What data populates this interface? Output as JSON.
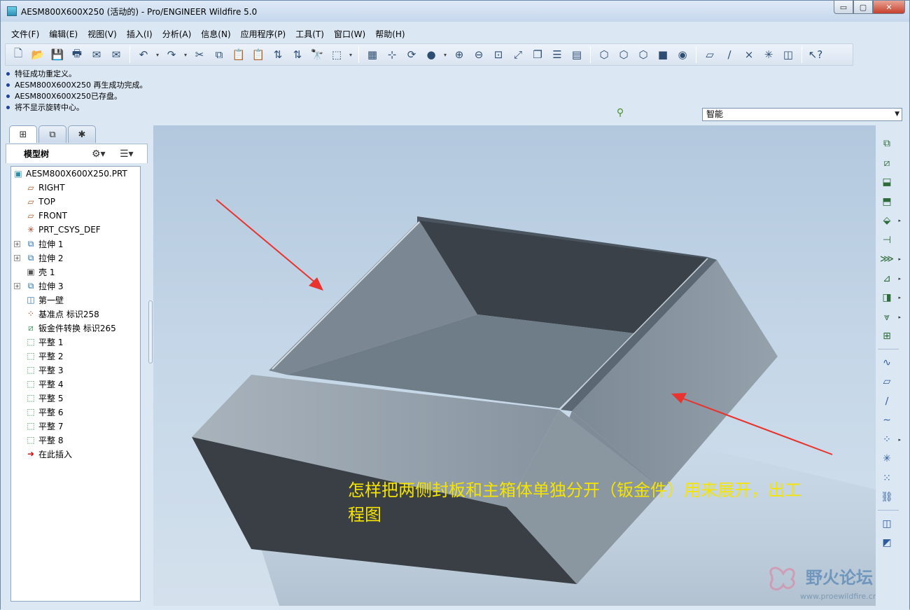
{
  "window": {
    "title": "AESM800X600X250 (活动的) - Pro/ENGINEER Wildfire 5.0",
    "buttons": {
      "minimize": "▭",
      "maximize": "▢",
      "close": "✕"
    }
  },
  "menubar": [
    "文件(F)",
    "编辑(E)",
    "视图(V)",
    "插入(I)",
    "分析(A)",
    "信息(N)",
    "应用程序(P)",
    "工具(T)",
    "窗口(W)",
    "帮助(H)"
  ],
  "toolbar": {
    "groups": [
      [
        "new-file",
        "open-file",
        "save",
        "print",
        "send-mail",
        "mail-attachment"
      ],
      [
        "undo",
        "redo",
        "cut",
        "copy",
        "paste",
        "paste-special",
        "regenerate",
        "regen-manager",
        "find",
        "select-box"
      ],
      [
        "repaint",
        "spin-center",
        "orient-mode",
        "appearance",
        "zoom-in",
        "zoom-out",
        "refit",
        "reorient",
        "saved-views",
        "layers",
        "view-manager"
      ],
      [
        "wireframe",
        "hidden-line",
        "no-hidden",
        "shading",
        "enhanced-realism"
      ],
      [
        "datum-plane-display",
        "datum-axis-display",
        "datum-point-display",
        "csys-display",
        "annotation-display"
      ],
      [
        "context-help"
      ]
    ],
    "glyphs": {
      "new-file": "🗋",
      "open-file": "📂",
      "save": "💾",
      "print": "🖶",
      "send-mail": "✉",
      "mail-attachment": "✉",
      "undo": "↶",
      "redo": "↷",
      "cut": "✂",
      "copy": "⧉",
      "paste": "📋",
      "paste-special": "📋",
      "regenerate": "⇅",
      "regen-manager": "⇅",
      "find": "🔭",
      "select-box": "⬚",
      "repaint": "▦",
      "spin-center": "⊹",
      "orient-mode": "⟳",
      "appearance": "●",
      "zoom-in": "⊕",
      "zoom-out": "⊖",
      "refit": "⊡",
      "reorient": "⤢",
      "saved-views": "❐",
      "layers": "☰",
      "view-manager": "▤",
      "wireframe": "⬡",
      "hidden-line": "⬡",
      "no-hidden": "⬡",
      "shading": "■",
      "enhanced-realism": "◉",
      "datum-plane-display": "▱",
      "datum-axis-display": "∕",
      "datum-point-display": "×",
      "csys-display": "✳",
      "annotation-display": "◫",
      "context-help": "↖?"
    }
  },
  "messages": [
    "特征成功重定义。",
    "AESM800X600X250 再生成功完成。",
    "AESM800X600X250已存盘。",
    "将不显示旋转中心。"
  ],
  "filter": {
    "value": "智能",
    "indicator": "⚲"
  },
  "navigator": {
    "tabs": [
      "model-tree-tab",
      "folder-browser-tab",
      "favorites-tab"
    ],
    "tab_glyphs": [
      "⊞",
      "⧉",
      "✱"
    ],
    "header_label": "模型树",
    "header_icons": {
      "settings": "⚙▾",
      "show": "☰▾"
    },
    "tree": [
      {
        "label": "AESM800X600X250.PRT",
        "icon": "part-icon",
        "glyph": "▣",
        "color": "#2a8fb0",
        "depth": 0,
        "expandable": false
      },
      {
        "label": "RIGHT",
        "icon": "datum-plane-icon",
        "glyph": "▱",
        "color": "#a35a2a",
        "depth": 1,
        "expandable": false
      },
      {
        "label": "TOP",
        "icon": "datum-plane-icon",
        "glyph": "▱",
        "color": "#a35a2a",
        "depth": 1,
        "expandable": false
      },
      {
        "label": "FRONT",
        "icon": "datum-plane-icon",
        "glyph": "▱",
        "color": "#a35a2a",
        "depth": 1,
        "expandable": false
      },
      {
        "label": "PRT_CSYS_DEF",
        "icon": "csys-icon",
        "glyph": "✳",
        "color": "#b04020",
        "depth": 1,
        "expandable": false
      },
      {
        "label": "拉伸 1",
        "icon": "extrude-icon",
        "glyph": "⧉",
        "color": "#2a6fb0",
        "depth": 1,
        "expandable": true
      },
      {
        "label": "拉伸 2",
        "icon": "extrude-icon",
        "glyph": "⧉",
        "color": "#2a6fb0",
        "depth": 1,
        "expandable": true
      },
      {
        "label": "壳 1",
        "icon": "shell-icon",
        "glyph": "▣",
        "color": "#555555",
        "depth": 1,
        "expandable": false
      },
      {
        "label": "拉伸 3",
        "icon": "extrude-icon",
        "glyph": "⧉",
        "color": "#2a6fb0",
        "depth": 1,
        "expandable": true
      },
      {
        "label": "第一壁",
        "icon": "first-wall-icon",
        "glyph": "◫",
        "color": "#2a6fb0",
        "depth": 1,
        "expandable": false
      },
      {
        "label": "基准点 标识258",
        "icon": "datum-point-icon",
        "glyph": "⁘",
        "color": "#b04020",
        "depth": 1,
        "expandable": false
      },
      {
        "label": "钣金件转换 标识265",
        "icon": "sheetmetal-convert-icon",
        "glyph": "⧄",
        "color": "#2a8f4a",
        "depth": 1,
        "expandable": false
      },
      {
        "label": "平整 1",
        "icon": "unbend-icon",
        "glyph": "⬚",
        "color": "#2a8f4a",
        "depth": 1,
        "expandable": false
      },
      {
        "label": "平整 2",
        "icon": "unbend-icon",
        "glyph": "⬚",
        "color": "#2a8f4a",
        "depth": 1,
        "expandable": false
      },
      {
        "label": "平整 3",
        "icon": "unbend-icon",
        "glyph": "⬚",
        "color": "#2a8f4a",
        "depth": 1,
        "expandable": false
      },
      {
        "label": "平整 4",
        "icon": "unbend-icon",
        "glyph": "⬚",
        "color": "#2a8f4a",
        "depth": 1,
        "expandable": false
      },
      {
        "label": "平整 5",
        "icon": "unbend-icon",
        "glyph": "⬚",
        "color": "#2a8f4a",
        "depth": 1,
        "expandable": false
      },
      {
        "label": "平整 6",
        "icon": "unbend-icon",
        "glyph": "⬚",
        "color": "#2a8f4a",
        "depth": 1,
        "expandable": false
      },
      {
        "label": "平整 7",
        "icon": "unbend-icon",
        "glyph": "⬚",
        "color": "#2a8f4a",
        "depth": 1,
        "expandable": false
      },
      {
        "label": "平整 8",
        "icon": "unbend-icon",
        "glyph": "⬚",
        "color": "#2a8f4a",
        "depth": 1,
        "expandable": false
      },
      {
        "label": "在此插入",
        "icon": "insert-here-icon",
        "glyph": "➜",
        "color": "#cc1111",
        "depth": 1,
        "expandable": false
      }
    ]
  },
  "right_toolbar": [
    {
      "name": "convert-icon",
      "glyph": "⧉",
      "dropdown": false
    },
    {
      "name": "wall-icon",
      "glyph": "⧄",
      "dropdown": false
    },
    {
      "name": "flange-icon",
      "glyph": "⬓",
      "dropdown": false
    },
    {
      "name": "flat-wall-icon",
      "glyph": "⬒",
      "dropdown": false
    },
    {
      "name": "extend-icon",
      "glyph": "⬙",
      "dropdown": true
    },
    {
      "name": "cut-icon",
      "glyph": "⊣",
      "dropdown": false
    },
    {
      "name": "bend-icon",
      "glyph": "⋙",
      "dropdown": true
    },
    {
      "name": "edge-bend-icon",
      "glyph": "⊿",
      "dropdown": true
    },
    {
      "name": "form-icon",
      "glyph": "◨",
      "dropdown": true
    },
    {
      "name": "unbend-icon",
      "glyph": "⩔",
      "dropdown": true
    },
    {
      "name": "flat-pattern-icon",
      "glyph": "⊞",
      "dropdown": false
    },
    {
      "name": "sketch-icon",
      "glyph": "∿",
      "dropdown": false
    },
    {
      "name": "datum-plane-icon",
      "glyph": "▱",
      "dropdown": false
    },
    {
      "name": "datum-axis-icon",
      "glyph": "∕",
      "dropdown": false
    },
    {
      "name": "datum-curve-icon",
      "glyph": "∼",
      "dropdown": false
    },
    {
      "name": "datum-point-icon",
      "glyph": "⁘",
      "dropdown": true
    },
    {
      "name": "csys-icon",
      "glyph": "✳",
      "dropdown": false
    },
    {
      "name": "analysis-icon",
      "glyph": "⁙",
      "dropdown": false
    },
    {
      "name": "datum-chain-icon",
      "glyph": "⛓",
      "dropdown": false
    },
    {
      "name": "annotation-icon",
      "glyph": "◫",
      "dropdown": false
    },
    {
      "name": "note-icon",
      "glyph": "◩",
      "dropdown": false
    }
  ],
  "annotation": {
    "line1": "怎样把两侧封板和主箱体单独分开（钣金件）用来展开，出工",
    "line2": "程图"
  },
  "watermark": {
    "brand": "野火论坛",
    "url": "www.proewildfire.cn"
  },
  "colors": {
    "annotation": "#f4e400",
    "arrow": "#e8332e",
    "panel": "#dce7f4"
  }
}
